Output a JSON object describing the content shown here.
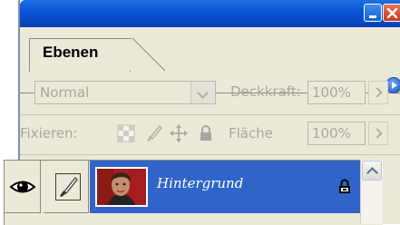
{
  "window": {
    "minimize_label": "",
    "close_label": ""
  },
  "tabs": [
    {
      "label": "Ebenen",
      "active": true
    }
  ],
  "blend": {
    "mode": "Normal",
    "opacity_label": "Deckkraft:",
    "opacity_value": "100%"
  },
  "lock": {
    "label": "Fixieren:",
    "icons": [
      "lock-transparency-icon",
      "lock-pixels-icon",
      "lock-position-icon",
      "lock-all-icon"
    ],
    "fill_label": "Fläche",
    "fill_value": "100%"
  },
  "layers": [
    {
      "name": "Hintergrund",
      "visible": true,
      "selected": true,
      "locked": true
    }
  ],
  "colors": {
    "title_bar": "#0a55d8",
    "selection": "#3164c8",
    "panel_bg": "#ece9d8",
    "disabled_text": "#a8a79f"
  }
}
